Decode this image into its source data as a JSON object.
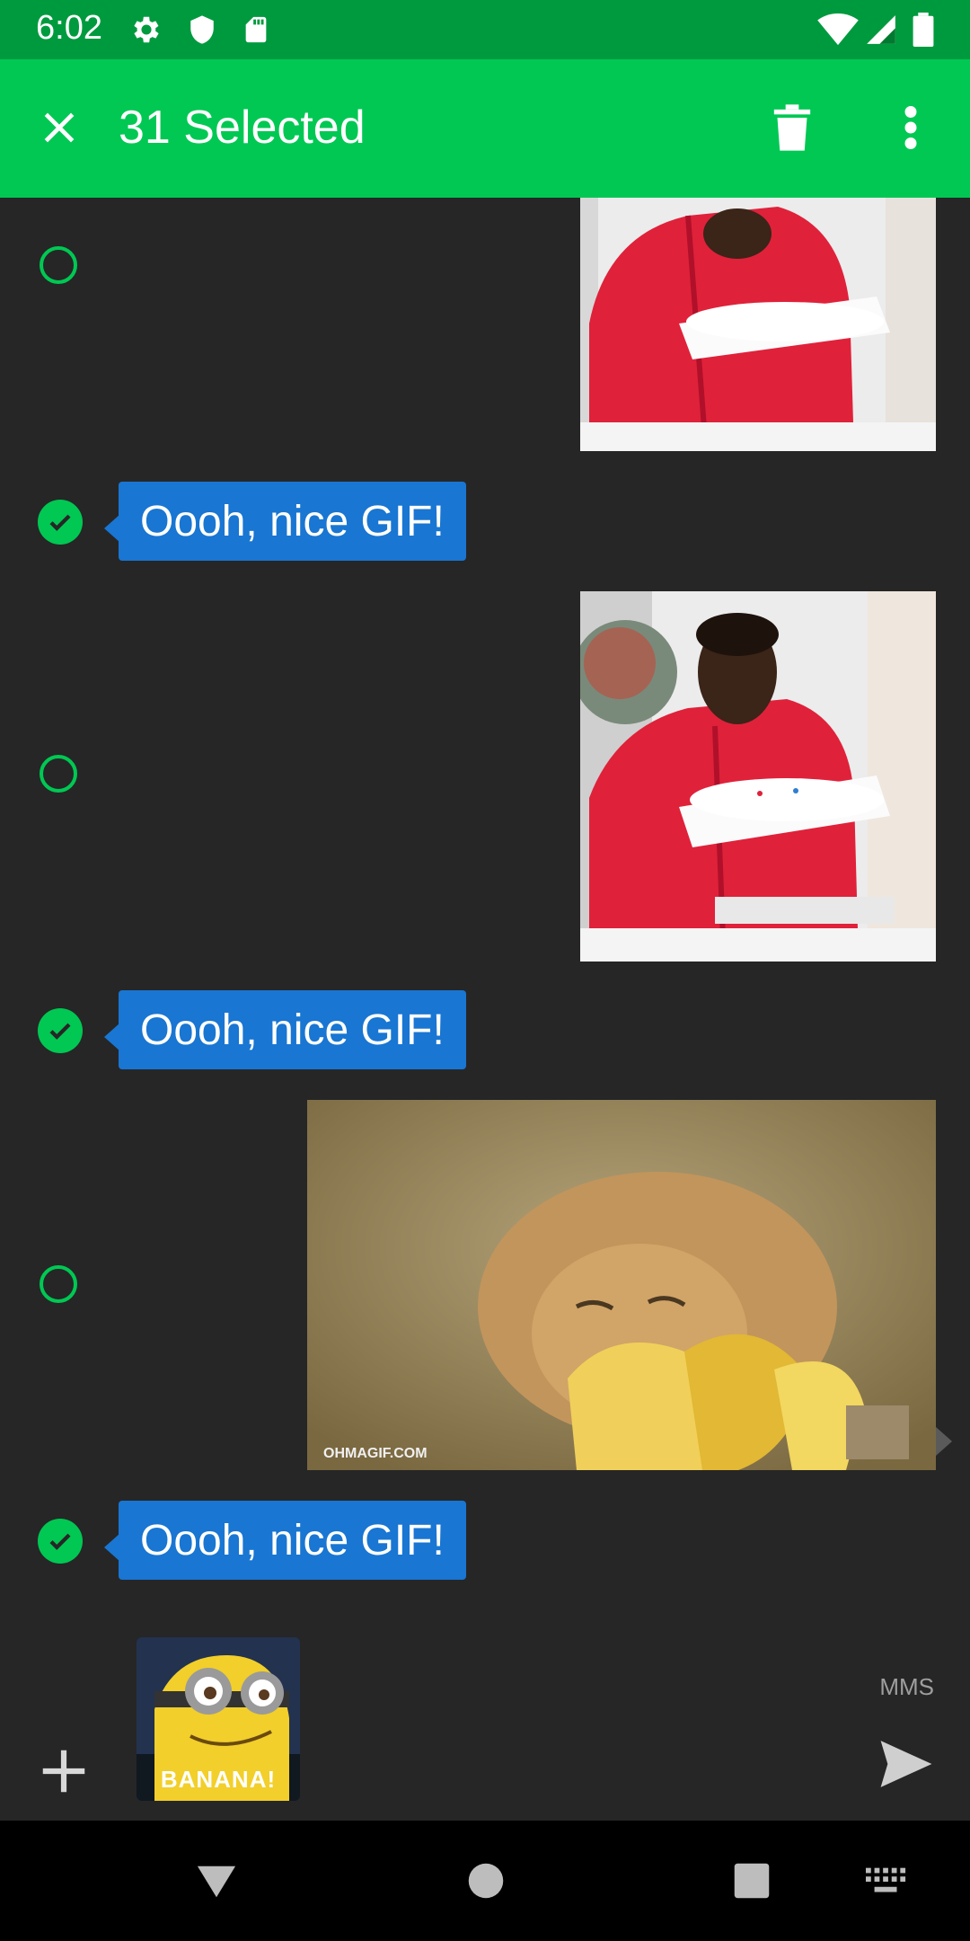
{
  "status_bar": {
    "time": "6:02",
    "icons": [
      "gear-icon",
      "shield-icon",
      "sd-card-icon",
      "wifi-icon",
      "signal-icon",
      "battery-icon"
    ]
  },
  "app_bar": {
    "title": "31 Selected",
    "close_icon": "close-icon",
    "delete_icon": "trash-icon",
    "more_icon": "more-vert-icon"
  },
  "colors": {
    "status_bar": "#009a3e",
    "app_bar": "#00c853",
    "background": "#262626",
    "bubble": "#1976d2",
    "select_accent": "#00c853"
  },
  "messages": [
    {
      "type": "image",
      "description": "man in red jacket holding cake (partial)",
      "selected": false
    },
    {
      "type": "text",
      "text": "Oooh, nice GIF!",
      "selected": true
    },
    {
      "type": "image",
      "description": "man in red jacket holding cake",
      "selected": false
    },
    {
      "type": "text",
      "text": "Oooh, nice GIF!",
      "selected": true
    },
    {
      "type": "image",
      "description": "cat eating banana",
      "watermark": "OHMAGIF.COM",
      "selected": false
    },
    {
      "type": "text",
      "text": "Oooh, nice GIF!",
      "selected": true
    }
  ],
  "composer": {
    "attachment_caption": "BANANA!",
    "mms_label": "MMS",
    "add_icon": "plus-icon",
    "send_icon": "send-icon"
  },
  "nav_bar": {
    "icons": [
      "back-icon",
      "home-icon",
      "recents-icon",
      "keyboard-icon"
    ]
  }
}
